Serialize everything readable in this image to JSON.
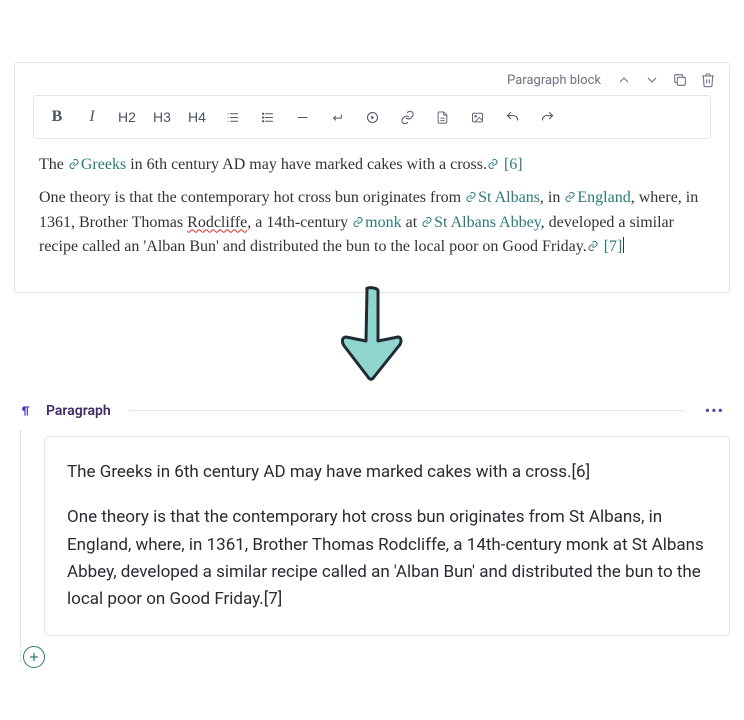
{
  "editor": {
    "block_label": "Paragraph block",
    "toolbar": {
      "bold": "B",
      "italic": "I",
      "h2": "H2",
      "h3": "H3",
      "h4": "H4"
    },
    "para1": {
      "t1": "The ",
      "link1": "Greeks",
      "t2": " in 6th century AD may have marked cakes with a cross.",
      "ref": "[6]"
    },
    "para2": {
      "t1": "One theory is that the contemporary hot cross bun originates from ",
      "link_stalbans": "St Albans",
      "t2": ", in ",
      "link_england": "England",
      "t3": ", where, in 1361, Brother Thomas ",
      "spell": "Rodcliffe",
      "t4": ", a 14th-century ",
      "link_monk": "monk",
      "t5": " at ",
      "link_abbey": "St Albans Abbey",
      "t6": ", developed a similar recipe called an 'Alban Bun' and distributed the bun to the local poor on Good Friday.",
      "ref": "[7]"
    }
  },
  "preview": {
    "title": "Paragraph",
    "para1": "The Greeks in 6th century AD may have marked cakes with a cross.[6]",
    "para2": "One theory is that the contemporary hot cross bun originates from St Albans, in England, where, in 1361, Brother Thomas Rodcliffe, a 14th-century monk at St Albans Abbey, developed a similar recipe called an 'Alban Bun' and distributed the bun to the local poor on Good Friday.[7]"
  }
}
